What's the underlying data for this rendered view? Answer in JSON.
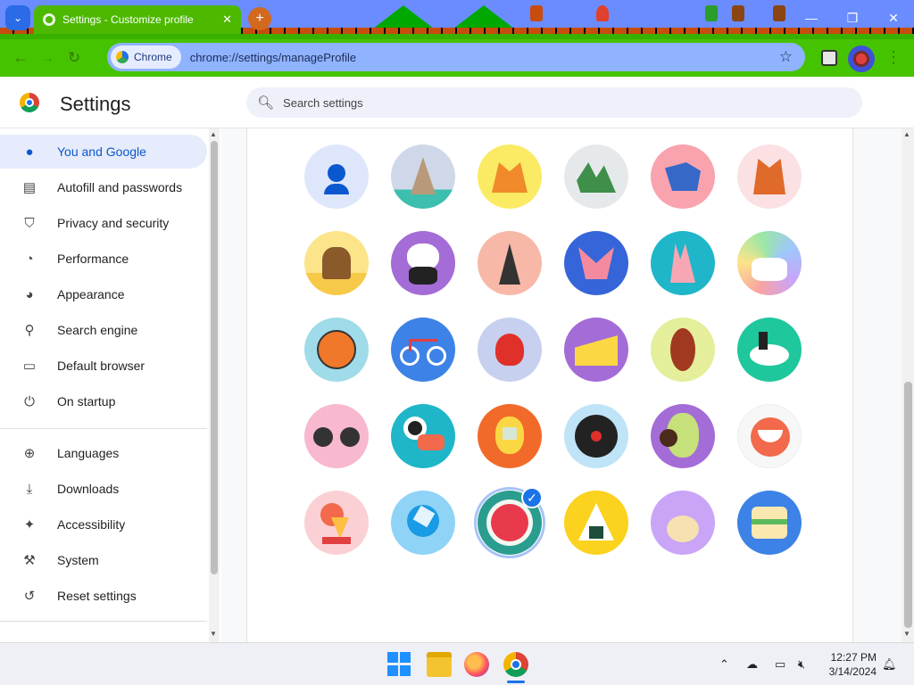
{
  "browser": {
    "tab_title": "Settings - Customize profile",
    "tab_close": "✕",
    "new_tab": "+",
    "chip_label": "Chrome",
    "url": "chrome://settings/manageProfile",
    "window_controls": {
      "minimize": "—",
      "restore": "❐",
      "close": "✕"
    }
  },
  "settings": {
    "title": "Settings",
    "search_placeholder": "Search settings"
  },
  "sidebar": {
    "items": [
      {
        "label": "You and Google",
        "icon": "person-icon",
        "active": true
      },
      {
        "label": "Autofill and passwords",
        "icon": "clipboard-icon"
      },
      {
        "label": "Privacy and security",
        "icon": "shield-icon"
      },
      {
        "label": "Performance",
        "icon": "gauge-icon"
      },
      {
        "label": "Appearance",
        "icon": "palette-icon"
      },
      {
        "label": "Search engine",
        "icon": "search-icon"
      },
      {
        "label": "Default browser",
        "icon": "browser-window-icon"
      },
      {
        "label": "On startup",
        "icon": "power-icon"
      },
      {
        "label": "Languages",
        "icon": "globe-icon"
      },
      {
        "label": "Downloads",
        "icon": "download-icon"
      },
      {
        "label": "Accessibility",
        "icon": "accessibility-icon"
      },
      {
        "label": "System",
        "icon": "wrench-icon"
      },
      {
        "label": "Reset settings",
        "icon": "reset-icon"
      }
    ]
  },
  "avatars": [
    [
      "generic-person",
      "cat",
      "fox",
      "dragon",
      "elephant",
      "orange-fox"
    ],
    [
      "monkey",
      "panda",
      "penguin",
      "butterfly",
      "rabbit",
      "unicorn"
    ],
    [
      "basketball",
      "bicycle",
      "bird",
      "cheese",
      "football",
      "sushi-plate"
    ],
    [
      "sunglasses",
      "sushi-rolls",
      "tamagotchi",
      "vinyl-record",
      "avocado",
      "smile"
    ],
    [
      "ice-cream",
      "popsicle",
      "watermelon",
      "onigiri",
      "pizza",
      "sandwich"
    ]
  ],
  "selected_avatar": "watermelon",
  "taskbar": {
    "time": "12:27 PM",
    "date": "3/14/2024"
  }
}
